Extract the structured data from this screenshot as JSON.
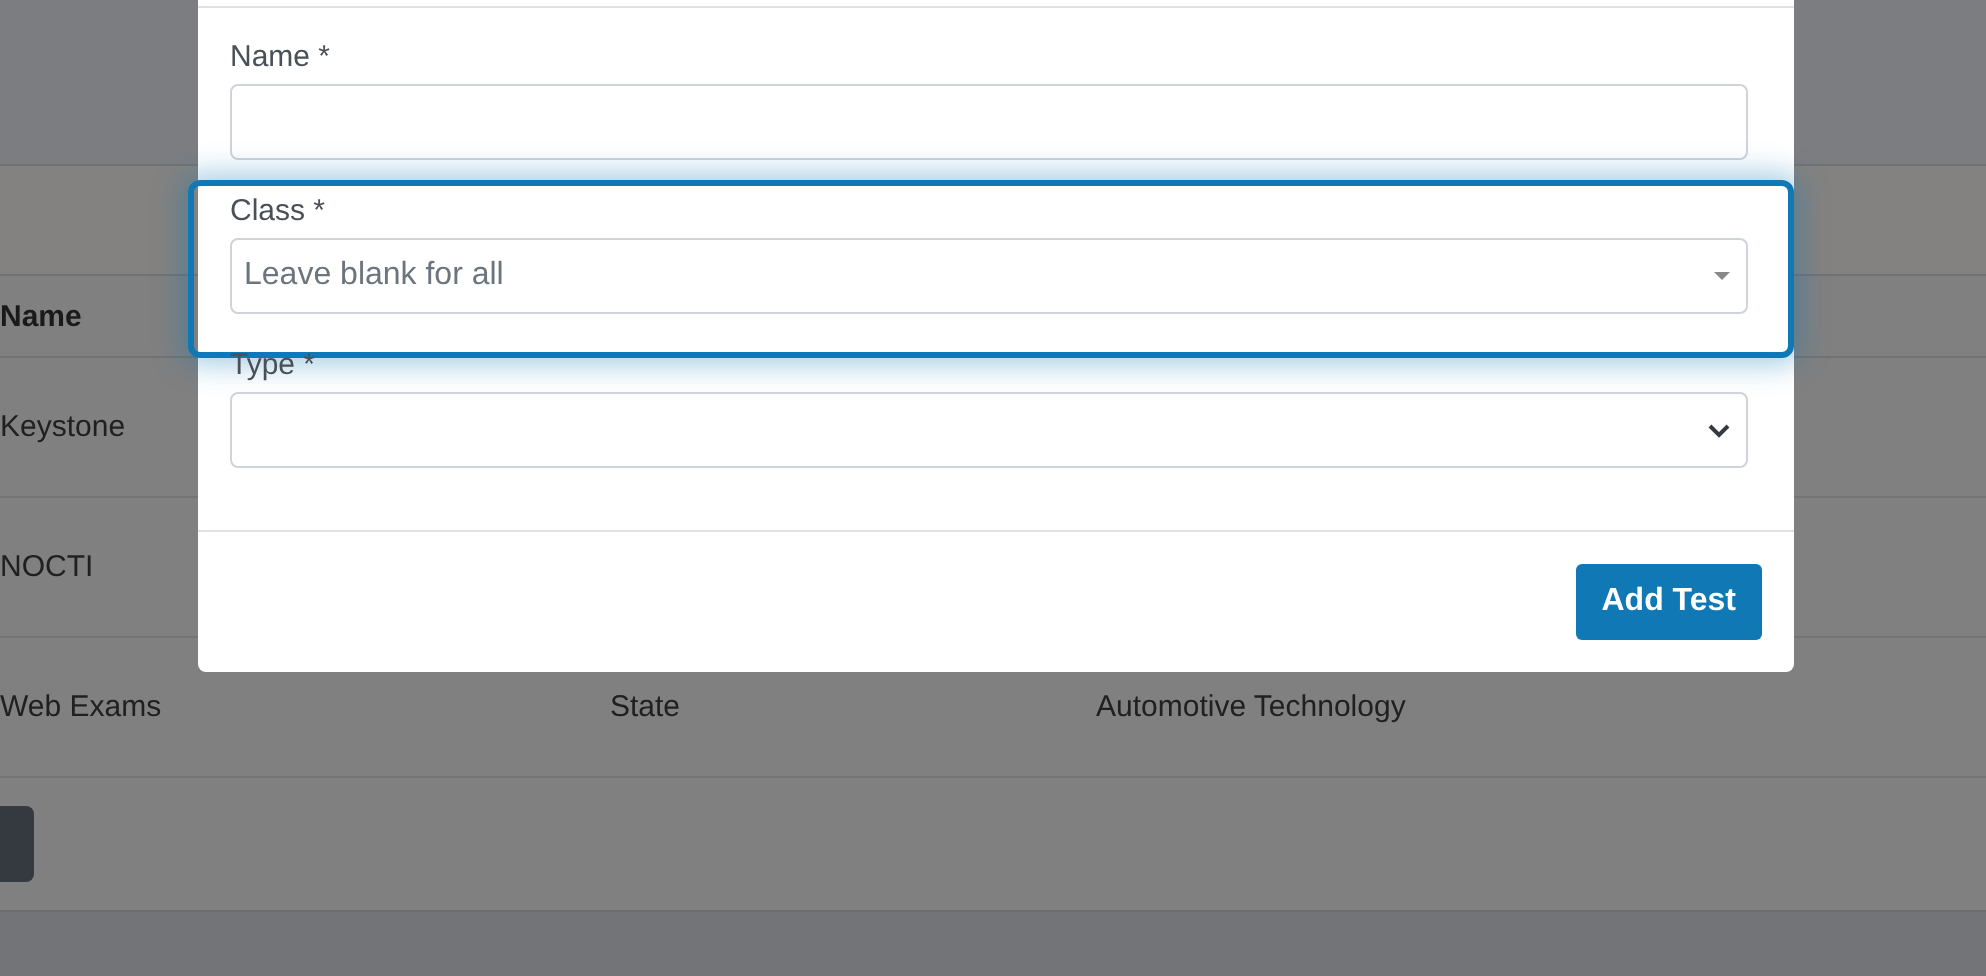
{
  "background_table": {
    "header": "Name",
    "rows": [
      {
        "name": "Keystone"
      },
      {
        "name": "NOCTI"
      },
      {
        "name": "Web Exams",
        "column_2": "State",
        "column_3": "Automotive Technology"
      }
    ]
  },
  "modal": {
    "fields": [
      {
        "label": "Name *",
        "kind": "text"
      },
      {
        "label": "Class *",
        "kind": "select2",
        "placeholder": "Leave blank for all",
        "highlighted": true
      },
      {
        "label": "Type *",
        "kind": "select",
        "highlighted": false
      }
    ],
    "submit": "Add Test"
  }
}
